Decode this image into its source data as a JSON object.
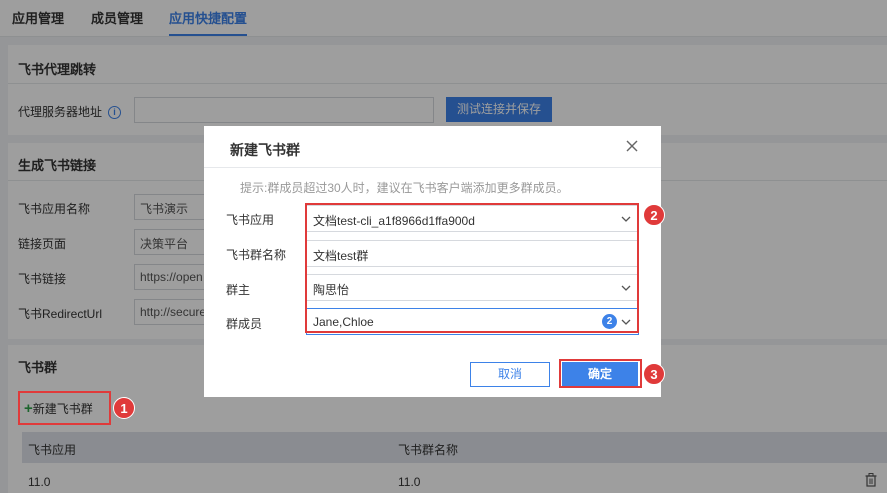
{
  "tabs": [
    "应用管理",
    "成员管理",
    "应用快捷配置"
  ],
  "proxy_section": {
    "title": "飞书代理跳转",
    "label": "代理服务器地址",
    "info_icon": "i",
    "test_button": "测试连接并保存"
  },
  "link_section": {
    "title": "生成飞书链接",
    "rows": [
      {
        "label": "飞书应用名称",
        "value": "飞书演示"
      },
      {
        "label": "链接页面",
        "value": "决策平台"
      },
      {
        "label": "飞书链接",
        "value": "https://open"
      },
      {
        "label": "飞书RedirectUrl",
        "value": "http://secure"
      }
    ]
  },
  "group_section": {
    "title": "飞书群",
    "new_button": "新建飞书群",
    "table": {
      "columns": [
        "飞书应用",
        "飞书群名称"
      ],
      "rows": [
        [
          "11.0",
          "11.0"
        ]
      ]
    }
  },
  "dialog": {
    "title": "新建飞书群",
    "hint": "提示:群成员超过30人时，建议在飞书客户端添加更多群成员。",
    "fields": [
      {
        "label": "飞书应用",
        "value": "文档test-cli_a1f8966d1ffa900d"
      },
      {
        "label": "飞书群名称",
        "value": "文档test群"
      },
      {
        "label": "群主",
        "value": "陶思怡"
      },
      {
        "label": "群成员",
        "value": "Jane,Chloe",
        "count": "2"
      }
    ],
    "cancel_label": "取消",
    "ok_label": "确定"
  },
  "callouts": [
    "1",
    "2",
    "3"
  ],
  "colors": {
    "accent": "#3d82e8",
    "highlight": "#e03a3a",
    "plus": "#2fa34a"
  }
}
